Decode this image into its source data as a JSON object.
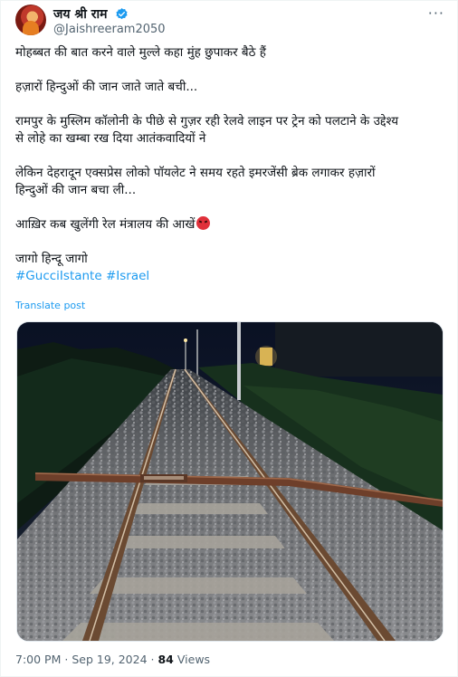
{
  "author": {
    "display_name": "जय श्री राम",
    "handle": "@Jaishreeram2050"
  },
  "tweet": {
    "lines": [
      "मोहब्बत की बात करने वाले मुल्ले कहा मुंह छुपाकर बैठे हैं",
      "",
      "हज़ारों हिन्दुओं की जान जाते जाते बची...",
      "",
      "रामपुर के मुस्लिम कॉलोनी के पीछे से गुज़र रही रेलवे लाइन पर ट्रेन को पलटाने के उद्देश्य",
      "से लोहे का खम्बा रख दिया आतंकवादियों ने",
      "",
      "लेकिन देहरादून एक्सप्रेस लोको पॉयलेट ने समय रहते इमरजेंसी ब्रेक लगाकर हज़ारों",
      "हिन्दुओं की जान बचा ली...",
      "",
      "आख़िर कब खुलेंगी रेल मंत्रालय की आखें",
      "",
      "जागो हिन्दू जागो"
    ],
    "hashtags": [
      "#GucciIstante",
      "#Israel"
    ],
    "emoji": "angry-face",
    "translate_label": "Translate post"
  },
  "meta": {
    "time": "7:00 PM",
    "separator": "·",
    "date": "Sep 19, 2024",
    "views_count": "84",
    "views_label": "Views"
  },
  "colors": {
    "link": "#1d9bf0",
    "secondary": "#536471",
    "verified": "#1d9bf0"
  }
}
